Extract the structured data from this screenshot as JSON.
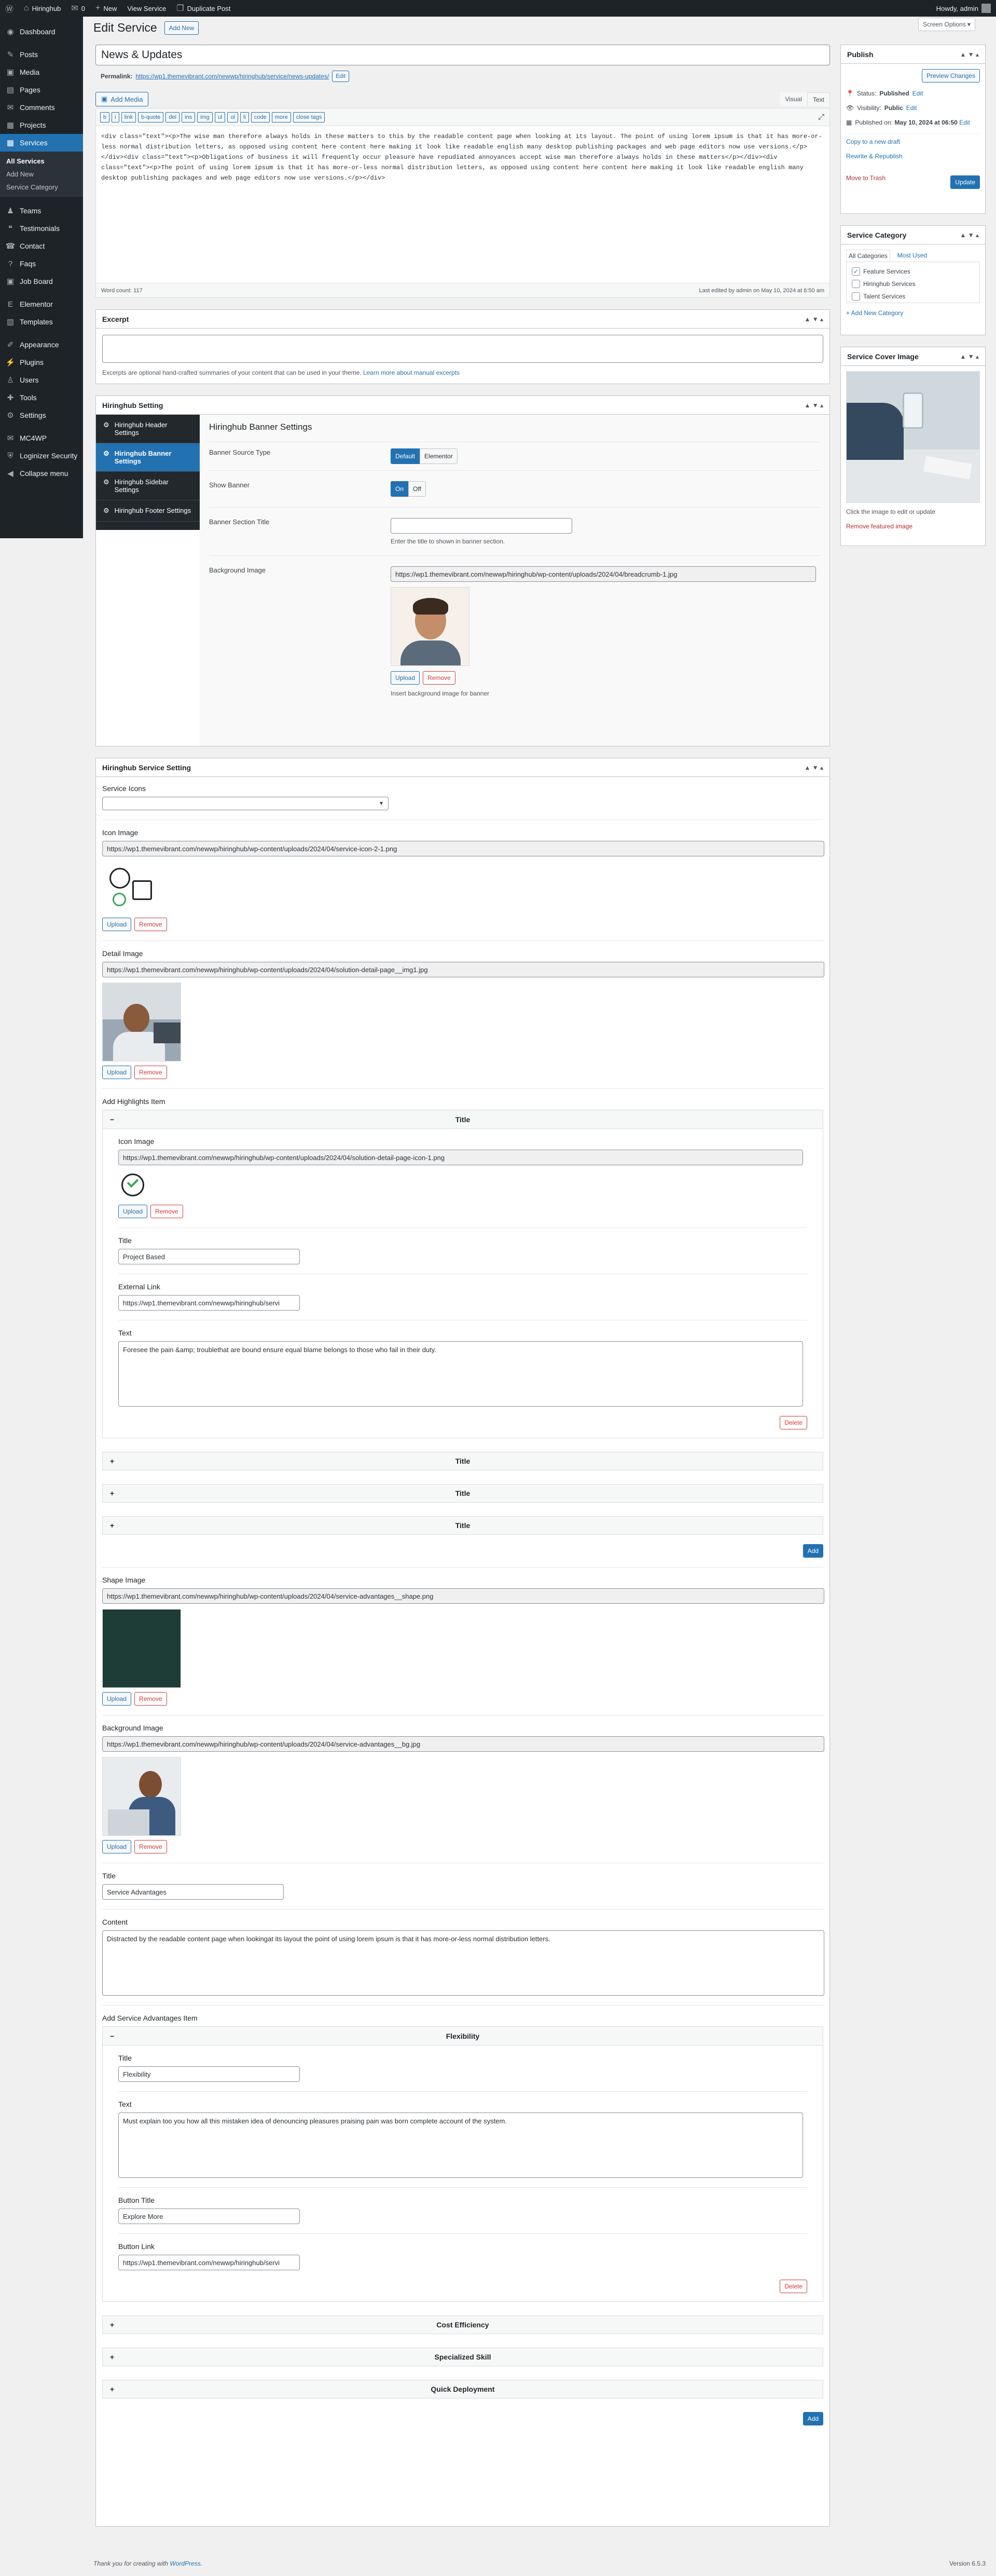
{
  "adminbar": {
    "site": "Hiringhub",
    "comments": "0",
    "new": "New",
    "view": "View Service",
    "duplicate": "Duplicate Post",
    "howdy": "Howdy, admin"
  },
  "menu": {
    "items": [
      {
        "label": "Dashboard",
        "icon": "dashboard-icon",
        "sym": "◉"
      },
      {
        "label": "Posts",
        "icon": "pin-icon",
        "sym": "✎"
      },
      {
        "label": "Media",
        "icon": "media-icon",
        "sym": "▣"
      },
      {
        "label": "Pages",
        "icon": "pages-icon",
        "sym": "▤"
      },
      {
        "label": "Comments",
        "icon": "comment-icon",
        "sym": "✉"
      },
      {
        "label": "Projects",
        "icon": "folder-icon",
        "sym": "▦"
      },
      {
        "label": "Services",
        "icon": "folder-icon",
        "sym": "▦"
      }
    ],
    "services_sub": [
      "All Services",
      "Add New",
      "Service Category"
    ],
    "items2": [
      {
        "label": "Teams",
        "icon": "team-icon",
        "sym": "♟"
      },
      {
        "label": "Testimonials",
        "icon": "quote-icon",
        "sym": "❝"
      },
      {
        "label": "Contact",
        "icon": "contact-icon",
        "sym": "☎"
      },
      {
        "label": "Faqs",
        "icon": "faq-icon",
        "sym": "?"
      },
      {
        "label": "Job Board",
        "icon": "briefcase-icon",
        "sym": "▣"
      },
      {
        "label": "Elementor",
        "icon": "elementor-icon",
        "sym": "E"
      },
      {
        "label": "Templates",
        "icon": "template-icon",
        "sym": "▥"
      },
      {
        "label": "Appearance",
        "icon": "brush-icon",
        "sym": "✐"
      },
      {
        "label": "Plugins",
        "icon": "plugin-icon",
        "sym": "⚡"
      },
      {
        "label": "Users",
        "icon": "user-icon",
        "sym": "♙"
      },
      {
        "label": "Tools",
        "icon": "wrench-icon",
        "sym": "✚"
      },
      {
        "label": "Settings",
        "icon": "gear-icon",
        "sym": "⚙"
      },
      {
        "label": "MC4WP",
        "icon": "mail-icon",
        "sym": "✉"
      },
      {
        "label": "Loginizer Security",
        "icon": "shield-icon",
        "sym": "⛨"
      },
      {
        "label": "Collapse menu",
        "icon": "collapse-icon",
        "sym": "◀"
      }
    ]
  },
  "header": {
    "title": "Edit Service",
    "add_new": "Add New",
    "screen_options": "Screen Options ▾"
  },
  "post": {
    "title": "News & Updates",
    "permalink_label": "Permalink:",
    "permalink": "https://wp1.themevibrant.com/newwp/hiringhub/service/news-updates/",
    "edit": "Edit"
  },
  "editor": {
    "add_media": "Add Media",
    "visual": "Visual",
    "text": "Text",
    "quicktags": [
      "b",
      "i",
      "link",
      "b-quote",
      "del",
      "ins",
      "img",
      "ul",
      "ol",
      "li",
      "code",
      "more",
      "close tags"
    ],
    "content": "<div class=\"text\"><p>The wise man therefore always holds in these matters to this by the readable content page when looking at its layout. The point of using lorem ipsum is that it has more-or-less normal distribution letters, as opposed using content here content here making it look like readable english many desktop publishing packages and web page editors now use versions.</p></div><div class=\"text\"><p>Obligations of business it will frequently occur pleasure have repudiated annoyances accept wise man therefore always holds in these matters</p></div><div class=\"text\"><p>The point of using lorem ipsum is that it has more-or-less normal distribution letters, as opposed using content here content here making it look like readable english many desktop publishing packages and web page editors now use versions.</p></div>",
    "word_count": "Word count: 117",
    "last_edited": "Last edited by admin on May 10, 2024 at 6:50 am"
  },
  "excerpt": {
    "title": "Excerpt",
    "help": "Excerpts are optional hand-crafted summaries of your content that can be used in your theme.",
    "link": "Learn more about manual excerpts"
  },
  "banner": {
    "box_title": "Hiringhub Setting",
    "tabs": [
      "Hiringhub Header Settings",
      "Hiringhub Banner Settings",
      "Hiringhub Sidebar Settings",
      "Hiringhub Footer Settings"
    ],
    "heading": "Hiringhub Banner Settings",
    "source_label": "Banner Source Type",
    "source_options": [
      "Default",
      "Elementor"
    ],
    "show_label": "Show Banner",
    "on": "On",
    "off": "Off",
    "section_title_label": "Banner Section Title",
    "section_title_help": "Enter the title to shown in banner section.",
    "bg_label": "Background Image",
    "bg_url": "https://wp1.themevibrant.com/newwp/hiringhub/wp-content/uploads/2024/04/breadcrumb-1.jpg",
    "upload": "Upload",
    "remove": "Remove",
    "bg_help": "Insert background image for banner"
  },
  "service": {
    "box_title": "Hiringhub Service Setting",
    "icons_label": "Service Icons",
    "icon_image_label": "Icon Image",
    "icon_url": "https://wp1.themevibrant.com/newwp/hiringhub/wp-content/uploads/2024/04/service-icon-2-1.png",
    "detail_label": "Detail Image",
    "detail_url": "https://wp1.themevibrant.com/newwp/hiringhub/wp-content/uploads/2024/04/solution-detail-page__img1.jpg",
    "highlights_label": "Add Highlights Item",
    "hl": {
      "header": "Title",
      "icon_label": "Icon Image",
      "icon_url": "https://wp1.themevibrant.com/newwp/hiringhub/wp-content/uploads/2024/04/solution-detail-page-icon-1.png",
      "title_label": "Title",
      "title": "Project Based",
      "link_label": "External Link",
      "link": "https://wp1.themevibrant.com/newwp/hiringhub/servi",
      "text_label": "Text",
      "text": "Foresee the pain &amp; troublethat are bound ensure equal blame belongs to those who fail in their duty."
    },
    "hl_collapsed": [
      "Title",
      "Title",
      "Title"
    ],
    "shape_label": "Shape Image",
    "shape_url": "https://wp1.themevibrant.com/newwp/hiringhub/wp-content/uploads/2024/04/service-advantages__shape.png",
    "bg_label": "Background Image",
    "bg_url": "https://wp1.themevibrant.com/newwp/hiringhub/wp-content/uploads/2024/04/service-advantages__bg.jpg",
    "title_label": "Title",
    "title": "Service Advantages",
    "content_label": "Content",
    "content": "Distracted by the readable content page when lookingat its layout the point of using lorem ipsum is that it has more-or-less normal distribution letters.",
    "adv_label": "Add Service Advantages Item",
    "adv": {
      "header": "Flexibility",
      "title_label": "Title",
      "title": "Flexibility",
      "text_label": "Text",
      "text": "Must explain too you how all this mistaken idea of denouncing pleasures praising pain was born complete account of the system.",
      "btn_title_label": "Button Title",
      "btn_title": "Explore More",
      "btn_link_label": "Button Link",
      "btn_link": "https://wp1.themevibrant.com/newwp/hiringhub/servi"
    },
    "adv_collapsed": [
      "Cost Efficiency",
      "Specialized Skill",
      "Quick Deployment"
    ],
    "upload": "Upload",
    "remove": "Remove",
    "delete": "Delete",
    "add": "Add",
    "minus": "−",
    "plus": "+"
  },
  "publish": {
    "title": "Publish",
    "preview": "Preview Changes",
    "status_label": "Status:",
    "status": "Published",
    "visibility_label": "Visibility:",
    "visibility": "Public",
    "published_label": "Published on:",
    "published": "May 10, 2024 at 06:50",
    "edit": "Edit",
    "copy_draft": "Copy to a new draft",
    "rewrite": "Rewrite & Republish",
    "trash": "Move to Trash",
    "update": "Update"
  },
  "category": {
    "title": "Service Category",
    "tab_all": "All Categories",
    "tab_used": "Most Used",
    "items": [
      {
        "label": "Feature Services",
        "checked": "✓"
      },
      {
        "label": "Hiringhub Services",
        "checked": ""
      },
      {
        "label": "Talent Services",
        "checked": ""
      }
    ],
    "add": "+ Add New Category"
  },
  "cover": {
    "title": "Service Cover Image",
    "help": "Click the image to edit or update",
    "remove": "Remove featured image"
  },
  "footer": {
    "thanks": "Thank you for creating with",
    "wp": "WordPress",
    "version": "Version 6.5.3"
  },
  "colors": {
    "primary": "#2271b1",
    "menu_bg": "#1d2327",
    "danger": "#d63638"
  }
}
